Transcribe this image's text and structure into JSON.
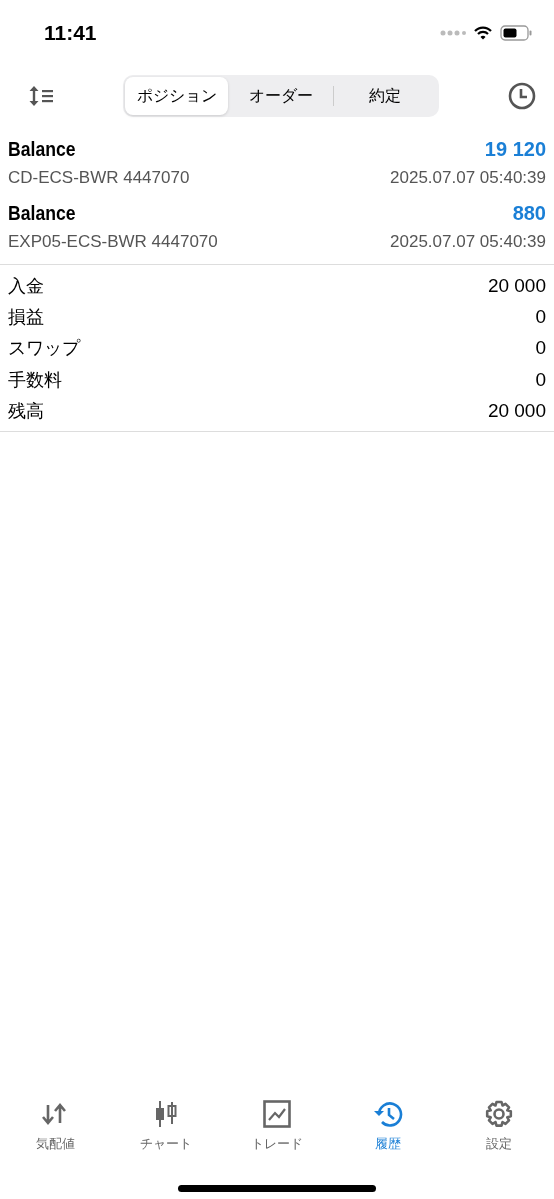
{
  "status_bar": {
    "time": "11:41"
  },
  "segments": [
    {
      "label": "ポジション",
      "selected": true
    },
    {
      "label": "オーダー",
      "selected": false
    },
    {
      "label": "約定",
      "selected": false
    }
  ],
  "deals": [
    {
      "type": "Balance",
      "amount": "19 120",
      "comment": "CD-ECS-BWR 4447070",
      "time": "2025.07.07 05:40:39"
    },
    {
      "type": "Balance",
      "amount": "880",
      "comment": "EXP05-ECS-BWR 4447070",
      "time": "2025.07.07 05:40:39"
    }
  ],
  "summary": [
    {
      "label": "入金",
      "value": "20 000"
    },
    {
      "label": "損益",
      "value": "0"
    },
    {
      "label": "スワップ",
      "value": "0"
    },
    {
      "label": "手数料",
      "value": "0"
    },
    {
      "label": "残高",
      "value": "20 000"
    }
  ],
  "tab_bar": [
    {
      "kind": "quotes",
      "label": "気配値",
      "selected": false
    },
    {
      "kind": "chart",
      "label": "チャート",
      "selected": false
    },
    {
      "kind": "trade",
      "label": "トレード",
      "selected": false
    },
    {
      "kind": "history",
      "label": "履歴",
      "selected": true
    },
    {
      "kind": "settings",
      "label": "設定",
      "selected": false
    }
  ]
}
